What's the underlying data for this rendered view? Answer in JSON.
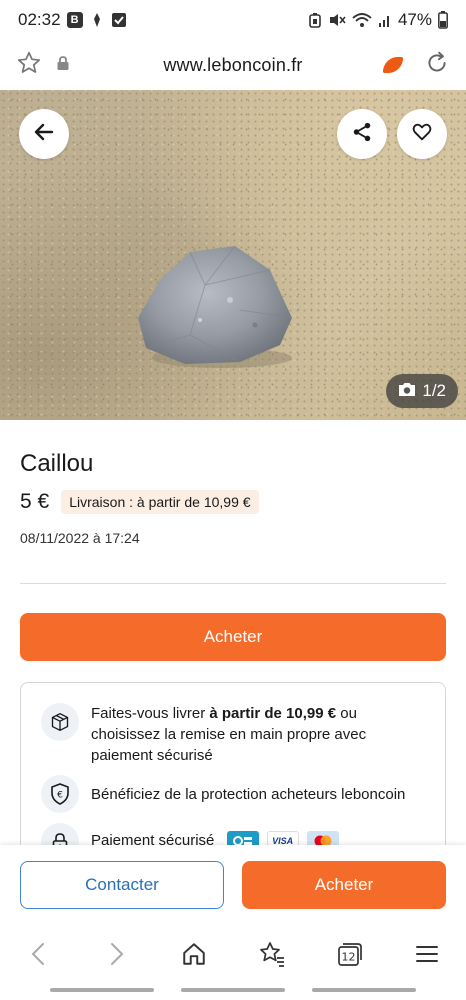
{
  "status_bar": {
    "time": "02:32",
    "battery": "47%",
    "left_icons": [
      "b-badge-icon",
      "assistant-icon",
      "checkbox-icon"
    ],
    "right_icons": [
      "lock-battery-icon",
      "mute-icon",
      "wifi-icon",
      "signal-icon",
      "battery-icon"
    ]
  },
  "browser": {
    "url": "www.leboncoin.fr",
    "icons": [
      "star-icon",
      "padlock-icon",
      "leboncoin-logo-icon",
      "reload-icon"
    ]
  },
  "hero": {
    "photo_counter": "1/2",
    "buttons": [
      "back-arrow-icon",
      "share-icon",
      "heart-icon"
    ]
  },
  "listing": {
    "title": "Caillou",
    "price": "5 €",
    "delivery_badge": "Livraison : à partir de 10,99 €",
    "date": "08/11/2022 à 17:24",
    "buy_label": "Acheter"
  },
  "info": {
    "delivery_pre": "Faites-vous livrer ",
    "delivery_bold": "à partir de 10,99 €",
    "delivery_post": " ou choisissez la remise en main propre avec paiement sécurisé",
    "protection": "Bénéficiez de la protection acheteurs leboncoin",
    "payment": "Paiement sécurisé",
    "card_logos": [
      {
        "name": "cb",
        "label": "CB",
        "color": "#1e9bc7"
      },
      {
        "name": "visa",
        "label": "VISA",
        "color": "#ffffff"
      },
      {
        "name": "mastercard",
        "label": "",
        "color": "#cfe3f5"
      }
    ]
  },
  "actions": {
    "contact_label": "Contacter",
    "buy_label": "Acheter"
  },
  "browser_nav": {
    "tabs_count": "12",
    "icons": [
      "nav-back-icon",
      "nav-forward-icon",
      "home-icon",
      "bookmarks-icon",
      "tabs-icon",
      "menu-icon"
    ]
  },
  "colors": {
    "accent": "#f56b2a",
    "contact_blue": "#2a6fb5",
    "badge_bg": "#fdeee4"
  }
}
